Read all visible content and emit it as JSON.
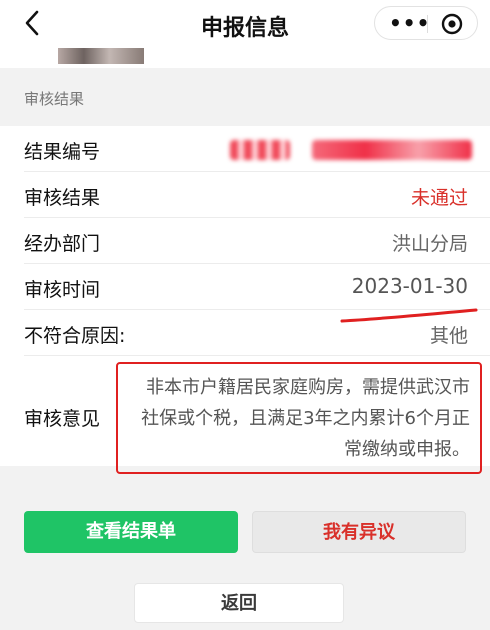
{
  "nav": {
    "back_glyph": "‹",
    "title": "申报信息",
    "more_glyph": "•••",
    "icons": [
      "back-icon",
      "more-icon",
      "close-miniapp-icon"
    ]
  },
  "section": {
    "header": "审核结果"
  },
  "rows": [
    {
      "label": "结果编号",
      "value": ""
    },
    {
      "label": "审核结果",
      "value": "未通过"
    },
    {
      "label": "经办部门",
      "value": "洪山分局"
    },
    {
      "label": "审核时间",
      "value": "2023-01-30"
    },
    {
      "label": "不符合原因:",
      "value": "其他"
    }
  ],
  "opinion": {
    "label": "审核意见",
    "text": "非本市户籍居民家庭购房，需提供武汉市社保或个税，且满足3年之内累计6个月正常缴纳或申报。"
  },
  "buttons": {
    "view_result": "查看结果单",
    "object": "我有异议",
    "back": "返回"
  },
  "colors": {
    "green": "#1fc466",
    "red": "#d9302a",
    "annotation_red": "#e02020"
  }
}
